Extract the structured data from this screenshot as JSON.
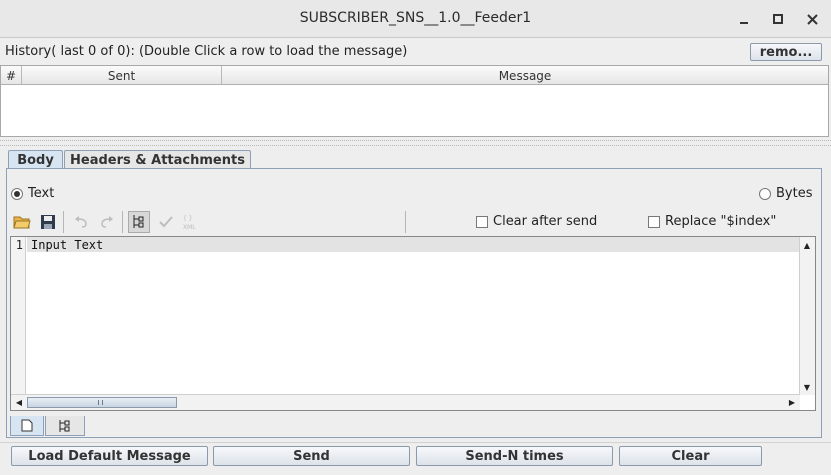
{
  "window": {
    "title": "SUBSCRIBER_SNS__1.0__Feeder1",
    "minimize_glyph": "▁",
    "maximize_glyph": "□",
    "close_glyph": "✕"
  },
  "history": {
    "label": "History( last 0 of 0):   (Double Click a row to load the message)",
    "remove_button": "remo...",
    "columns": [
      "#",
      "Sent",
      "Message"
    ],
    "rows": []
  },
  "tabs": [
    {
      "label": "Body",
      "active": true
    },
    {
      "label": "Headers & Attachments",
      "active": false
    }
  ],
  "body": {
    "text_radio": "Text",
    "bytes_radio": "Bytes",
    "selected_format": "Text",
    "clear_after_send": "Clear after send",
    "replace_index": "Replace \"$index\"",
    "toolbar_icons": [
      "open-folder-icon",
      "save-icon",
      "undo-icon",
      "redo-icon",
      "tree-view-icon",
      "validate-check-icon",
      "format-xml-icon"
    ]
  },
  "editor": {
    "line_numbers": [
      "1"
    ],
    "lines": [
      "Input Text"
    ]
  },
  "bottom_buttons": {
    "load_default": "Load Default Message",
    "send": "Send",
    "send_n": "Send-N times",
    "clear": "Clear"
  },
  "colors": {
    "active_tab": "#d7e4f2",
    "border_blue": "#8da0b6"
  }
}
